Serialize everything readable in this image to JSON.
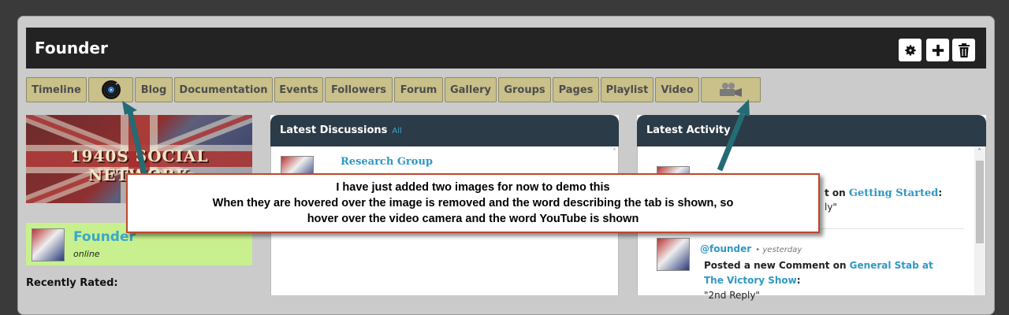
{
  "header": {
    "title": "Founder"
  },
  "tabs": [
    {
      "label": "Timeline",
      "type": "text"
    },
    {
      "label": "",
      "type": "icon",
      "icon": "vinyl-record-icon"
    },
    {
      "label": "Blog",
      "type": "text"
    },
    {
      "label": "Documentation",
      "type": "text"
    },
    {
      "label": "Events",
      "type": "text"
    },
    {
      "label": "Followers",
      "type": "text"
    },
    {
      "label": "Forum",
      "type": "text"
    },
    {
      "label": "Gallery",
      "type": "text"
    },
    {
      "label": "Groups",
      "type": "text"
    },
    {
      "label": "Pages",
      "type": "text"
    },
    {
      "label": "Playlist",
      "type": "text"
    },
    {
      "label": "Video",
      "type": "text"
    },
    {
      "label": "",
      "type": "icon",
      "icon": "video-camera-icon"
    }
  ],
  "banner": {
    "text": "1940S SOCIAL NETWORK"
  },
  "profile": {
    "name": "Founder",
    "status": "online"
  },
  "sidebar": {
    "recently_rated": "Recently Rated:"
  },
  "discussions": {
    "title": "Latest Discussions",
    "all": "All",
    "items": [
      {
        "title": "Research Group"
      }
    ]
  },
  "activity": {
    "title": "Latest Activity",
    "items": [
      {
        "prefix": "t on ",
        "link": "Getting Started",
        "suffix": ":",
        "reply": "ly\""
      },
      {
        "user": "@founder",
        "time": "• yesterday",
        "action": "Posted a new Comment on ",
        "link": "General Stab at The Victory Show",
        "suffix": ":",
        "reply": "\"2nd Reply\""
      }
    ]
  },
  "callout": {
    "line1": "I have just added two images for now to demo this",
    "line2": "When they are hovered over the image is removed and the word describing the tab is shown, so",
    "line3": "hover over the video camera and the word YouTube is shown"
  },
  "colors": {
    "tab_bg": "#c9c08a",
    "header_bg": "#232323",
    "panel_head_bg": "#2b3b47",
    "link": "#2f98c4",
    "arrow": "#256b73",
    "callout_border": "#c0472c"
  }
}
